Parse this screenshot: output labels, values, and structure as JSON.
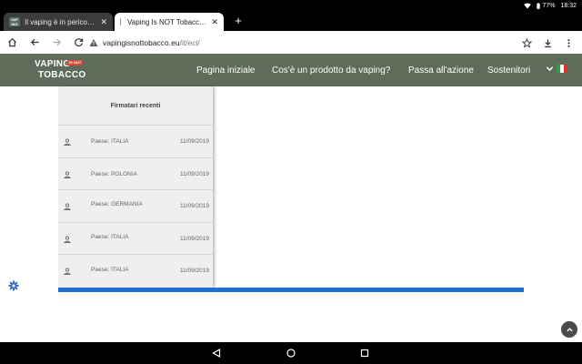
{
  "status_bar": {
    "battery": "77%",
    "time": "18:32"
  },
  "tabs": [
    {
      "title": "Il vaping è in pericolo! firma la",
      "favicon": "VAPING"
    },
    {
      "title": "Vaping Is NOT Tobacco | Firm",
      "favicon": ""
    }
  ],
  "new_tab": "+",
  "url": {
    "host": "vapingisnottobacco.eu",
    "path": "/it/eci/"
  },
  "site": {
    "logo_line1": "VAPING",
    "logo_badge": "IS NOT",
    "logo_line2": "TOBACCO",
    "nav": [
      "Pagina iniziale",
      "Cos'è un prodotto da vaping?",
      "Passa all'azione",
      "Sostenitori"
    ]
  },
  "signers": {
    "title": "Firmatari recenti",
    "country_prefix": "Paese:",
    "rows": [
      {
        "country": "ITALIA",
        "date": "11/09/2019"
      },
      {
        "country": "POLONIA",
        "date": "11/09/2019"
      },
      {
        "country": "GERMANIA",
        "date": "11/09/2019"
      },
      {
        "country": "ITALIA",
        "date": "11/09/2019"
      },
      {
        "country": "ITALIA",
        "date": "11/09/2019"
      }
    ]
  },
  "colors": {
    "header": "#5e6d5a",
    "accent_bar": "#1e6fd0",
    "gear": "#3b6fc7"
  }
}
